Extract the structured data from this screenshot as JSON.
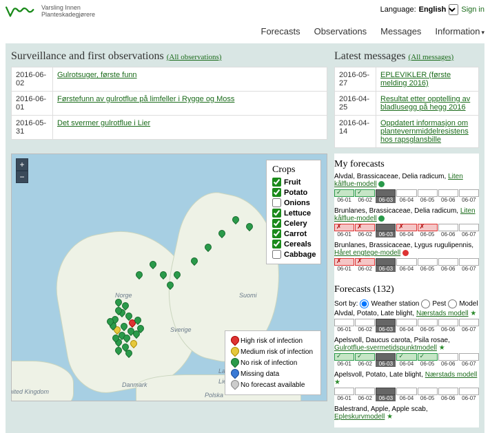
{
  "header": {
    "brand_line1": "Varsling Innen",
    "brand_line2": "Planteskadegjørere",
    "language_label": "Language:",
    "language_value": "English",
    "signin": "Sign in"
  },
  "nav": {
    "forecasts": "Forecasts",
    "observations": "Observations",
    "messages": "Messages",
    "information": "Information"
  },
  "surveillance": {
    "title": "Surveillance and first observations",
    "all_link": "(All observations)",
    "rows": [
      {
        "date": "2016-06-02",
        "text": "Gulrotsuger, første funn"
      },
      {
        "date": "2016-06-01",
        "text": "Førstefunn av gulrotflue på limfeller i Rygge og Moss"
      },
      {
        "date": "2016-05-31",
        "text": "Det svermer gulrotflue i Lier"
      }
    ]
  },
  "latest_messages": {
    "title": "Latest messages",
    "all_link": "(All messages)",
    "rows": [
      {
        "date": "2016-05-27",
        "text": "EPLEVIKLER (første melding 2016)"
      },
      {
        "date": "2016-04-25",
        "text": "Resultat etter opptelling av bladlusegg på hegg 2016"
      },
      {
        "date": "2016-04-14",
        "text": "Oppdatert informasjon om plantevernmiddelresistens hos rapsglansbille"
      }
    ]
  },
  "crops": {
    "title": "Crops",
    "items": [
      {
        "label": "Fruit",
        "checked": true
      },
      {
        "label": "Potato",
        "checked": true
      },
      {
        "label": "Onions",
        "checked": false
      },
      {
        "label": "Lettuce",
        "checked": true
      },
      {
        "label": "Celery",
        "checked": true
      },
      {
        "label": "Carrot",
        "checked": true
      },
      {
        "label": "Cereals",
        "checked": true
      },
      {
        "label": "Cabbage",
        "checked": false
      }
    ]
  },
  "legend": {
    "items": [
      {
        "label": "High risk of infection",
        "c": "red"
      },
      {
        "label": "Medium risk of infection",
        "c": "yellow"
      },
      {
        "label": "No risk of infection",
        "c": "green"
      },
      {
        "label": "Missing data",
        "c": "blue"
      },
      {
        "label": "No forecast available",
        "c": "gray"
      }
    ]
  },
  "map_labels": {
    "norge": "Norge",
    "sverige": "Sverige",
    "suomi": "Suomi",
    "danmark": "Danmark",
    "uk": "United Kingdom",
    "latvija": "Latvija",
    "lietuva": "Lietuva",
    "polska": "Polska"
  },
  "my_forecasts": {
    "title": "My forecasts",
    "days": [
      "06-01",
      "06-02",
      "06-03",
      "06-04",
      "06-05",
      "06-06",
      "06-07"
    ],
    "items": [
      {
        "where": "Alvdal, Brassicaceae, Delia radicum, ",
        "link": "Liten kålflue-modell",
        "status": "green",
        "cells": [
          "green",
          "green",
          "dark",
          "",
          "",
          "",
          ""
        ]
      },
      {
        "where": "Brunlanes, Brassicaceae, Delia radicum, ",
        "link": "Liten kålflue-modell",
        "status": "green",
        "cells": [
          "red",
          "red",
          "dark",
          "red",
          "red",
          "",
          ""
        ]
      },
      {
        "where": "Brunlanes, Brassicaceae, Lygus rugulipennis, ",
        "link": "Håret engtege-modell",
        "status": "red",
        "cells": [
          "red",
          "red",
          "dark",
          "",
          "",
          "",
          ""
        ]
      }
    ]
  },
  "forecasts_list": {
    "title": "Forecasts (132)",
    "sort_label": "Sort by:",
    "sort_options": {
      "weather": "Weather station",
      "pest": "Pest",
      "model": "Model"
    },
    "sort_selected": "weather",
    "days": [
      "06-01",
      "06-02",
      "06-03",
      "06-04",
      "06-05",
      "06-06",
      "06-07"
    ],
    "items": [
      {
        "where": "Alvdal, Potato, Late blight, ",
        "link": "Nærstads modell",
        "star": true,
        "cells": [
          "",
          "",
          "dark",
          "",
          "",
          "",
          ""
        ]
      },
      {
        "where": "Apelsvoll, Daucus carota, Psila rosae, ",
        "link": "Gulrotflue-svermetidspunktmodell",
        "star": true,
        "cells": [
          "green",
          "green",
          "dark",
          "green",
          "green",
          "",
          ""
        ]
      },
      {
        "where": "Apelsvoll, Potato, Late blight, ",
        "link": "Nærstads modell",
        "star": true,
        "cells": [
          "",
          "",
          "dark",
          "",
          "",
          "",
          ""
        ]
      },
      {
        "where": "Balestrand, Apple, Apple scab, ",
        "link": "Epleskurvmodell",
        "star": true,
        "cells": []
      }
    ]
  }
}
